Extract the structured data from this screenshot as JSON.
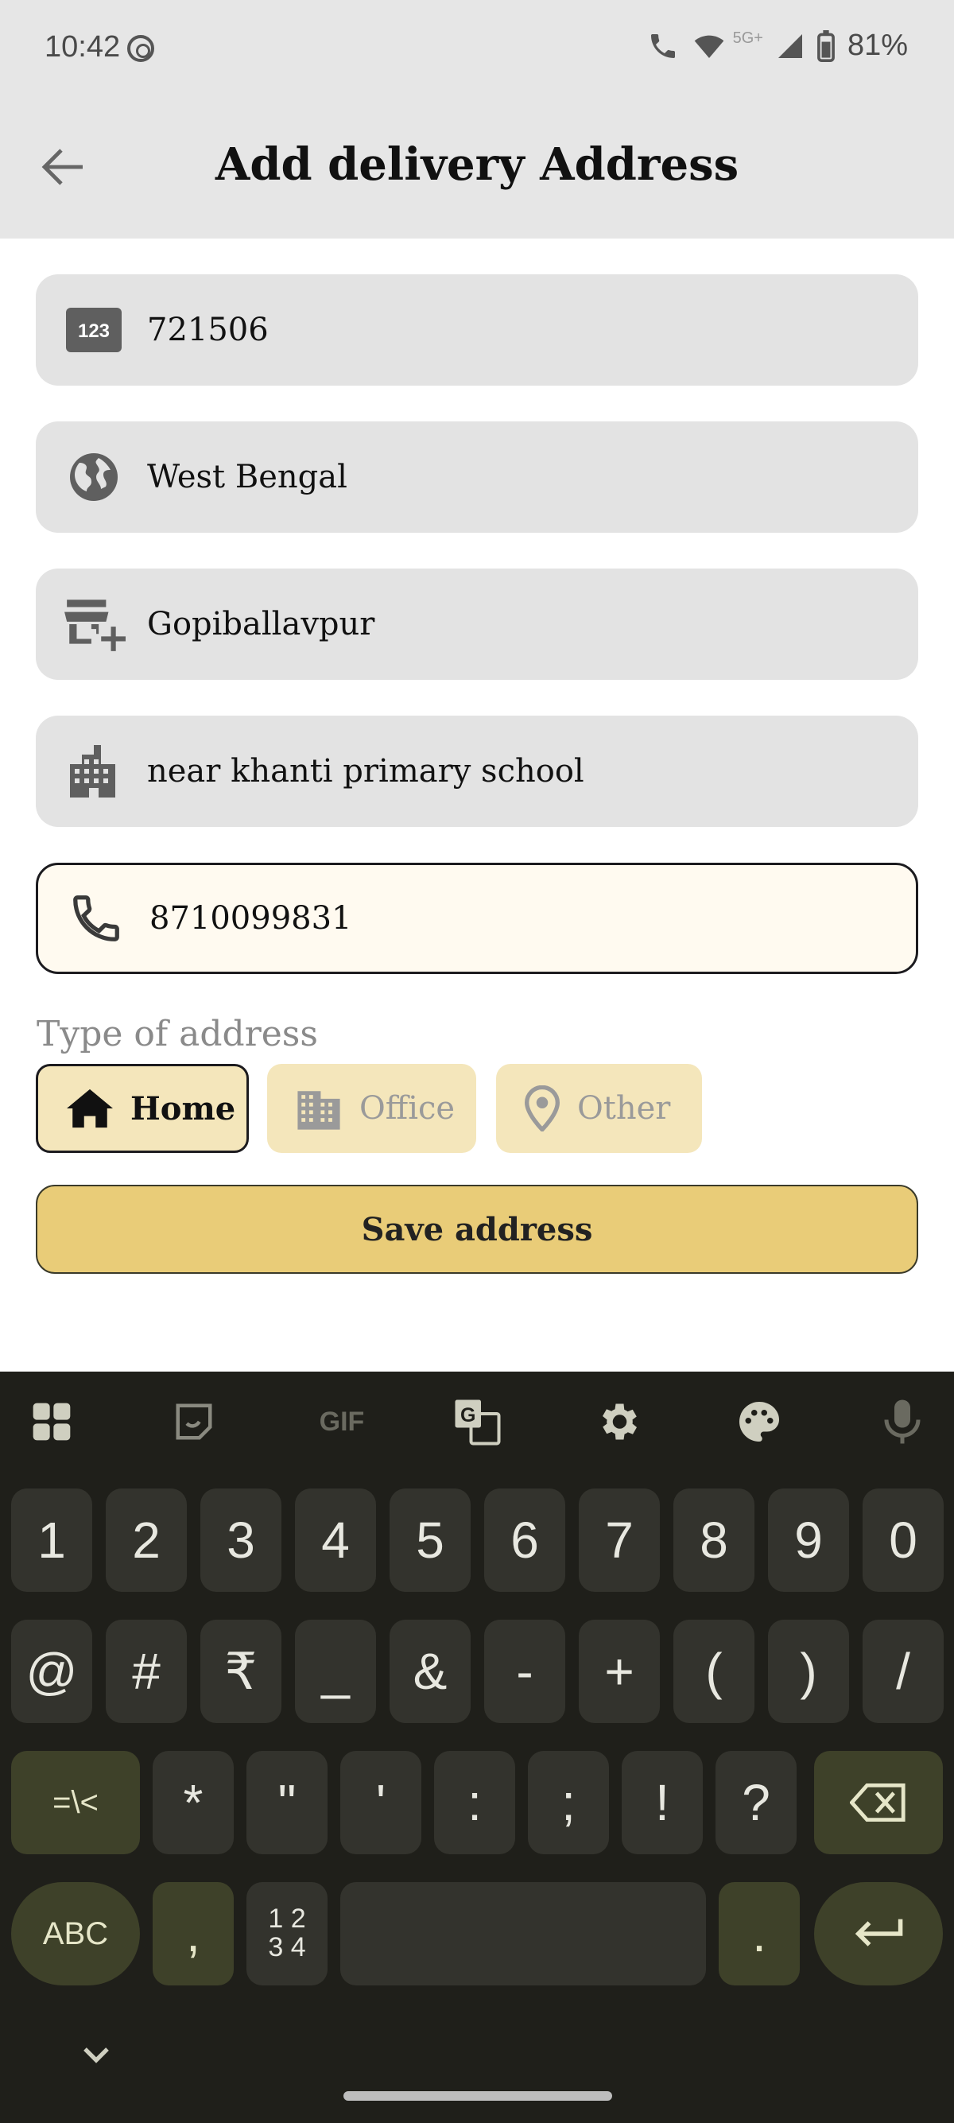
{
  "status_bar": {
    "time": "10:42",
    "network": "5G+",
    "battery": "81%"
  },
  "app_bar": {
    "title": "Add delivery Address",
    "back_icon": "arrow-back-icon"
  },
  "fields": [
    {
      "name": "pincode",
      "icon": "number-123-icon",
      "value": "721506"
    },
    {
      "name": "state",
      "icon": "globe-icon",
      "value": "West Bengal"
    },
    {
      "name": "city",
      "icon": "add-business-icon",
      "value": "Gopiballavpur"
    },
    {
      "name": "landmark",
      "icon": "apartment-icon",
      "value": "near khanti primary school"
    },
    {
      "name": "phone",
      "icon": "phone-icon",
      "value": "8710099831"
    }
  ],
  "type_of_address": {
    "label": "Type of address",
    "options": [
      {
        "label": "Home",
        "icon": "home-icon",
        "selected": true
      },
      {
        "label": "Office",
        "icon": "office-building-icon",
        "selected": false
      },
      {
        "label": "Other",
        "icon": "location-pin-icon",
        "selected": false
      }
    ]
  },
  "save_button": {
    "label": "Save address"
  },
  "keyboard": {
    "toolbar": [
      "apps-grid-icon",
      "sticker-icon",
      "GIF",
      "translate-icon",
      "settings-gear-icon",
      "palette-icon",
      "microphone-icon"
    ],
    "row1": [
      "1",
      "2",
      "3",
      "4",
      "5",
      "6",
      "7",
      "8",
      "9",
      "0"
    ],
    "row2": [
      "@",
      "#",
      "₹",
      "_",
      "&",
      "-",
      "+",
      "(",
      ")",
      "/"
    ],
    "row3": [
      "=\\<",
      "*",
      "\"",
      "'",
      ":",
      ";",
      "!",
      "?"
    ],
    "row4": {
      "abc": "ABC",
      "comma": ",",
      "numpad": "1 2\n3 4",
      "period": "."
    }
  },
  "colors": {
    "accent": "#e9cc78",
    "chip_bg": "#f4e6bb",
    "field_bg": "#e3e3e3",
    "keyboard_bg": "#1f1f1a"
  }
}
